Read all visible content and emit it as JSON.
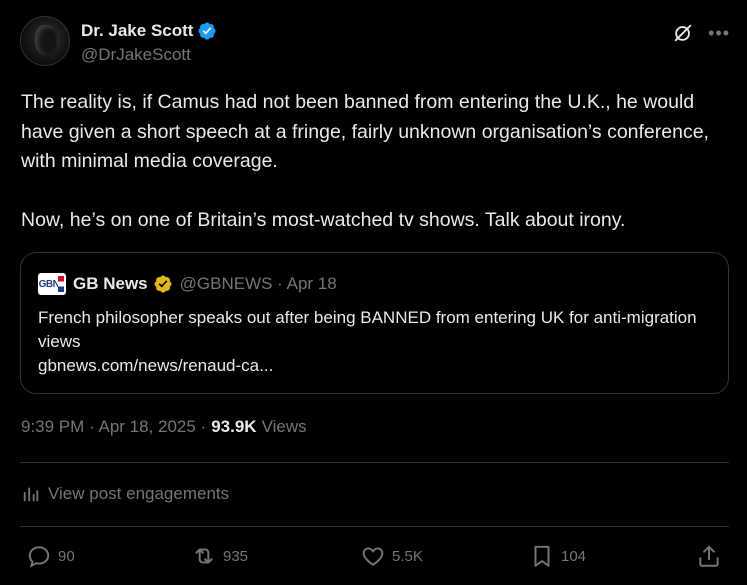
{
  "author": {
    "display_name": "Dr. Jake Scott",
    "handle": "@DrJakeScott"
  },
  "icons": {
    "verified": "verified-badge-icon",
    "grok": "grok-icon",
    "more": "more-icon"
  },
  "post": {
    "paragraph_1": "The reality is, if Camus had not been banned from entering the U.K., he would have given a short speech at a fringe, fairly unknown organisation’s conference, with minimal media coverage.",
    "paragraph_2": "Now, he’s on one of Britain’s most-watched tv shows. Talk about irony."
  },
  "quote": {
    "logo_text": "GBN",
    "name": "GB News",
    "handle_date": "@GBNEWS · Apr 18",
    "text_line": "French philosopher speaks out after being BANNED from entering UK for anti-migration views",
    "link": "gbnews.com/news/renaud-ca..."
  },
  "meta": {
    "time_date": "9:39 PM · Apr 18, 2025 ·",
    "views_count": "93.9K",
    "views_label": "Views"
  },
  "engagements_label": "View post engagements",
  "actions": {
    "replies": "90",
    "reposts": "935",
    "likes": "5.5K",
    "bookmarks": "104"
  },
  "colors": {
    "background": "#000000",
    "text": "#e7e9ea",
    "muted": "#71767b",
    "border": "#2f3336",
    "verified_blue": "#1d9bf0",
    "gold": "#e2b719"
  }
}
